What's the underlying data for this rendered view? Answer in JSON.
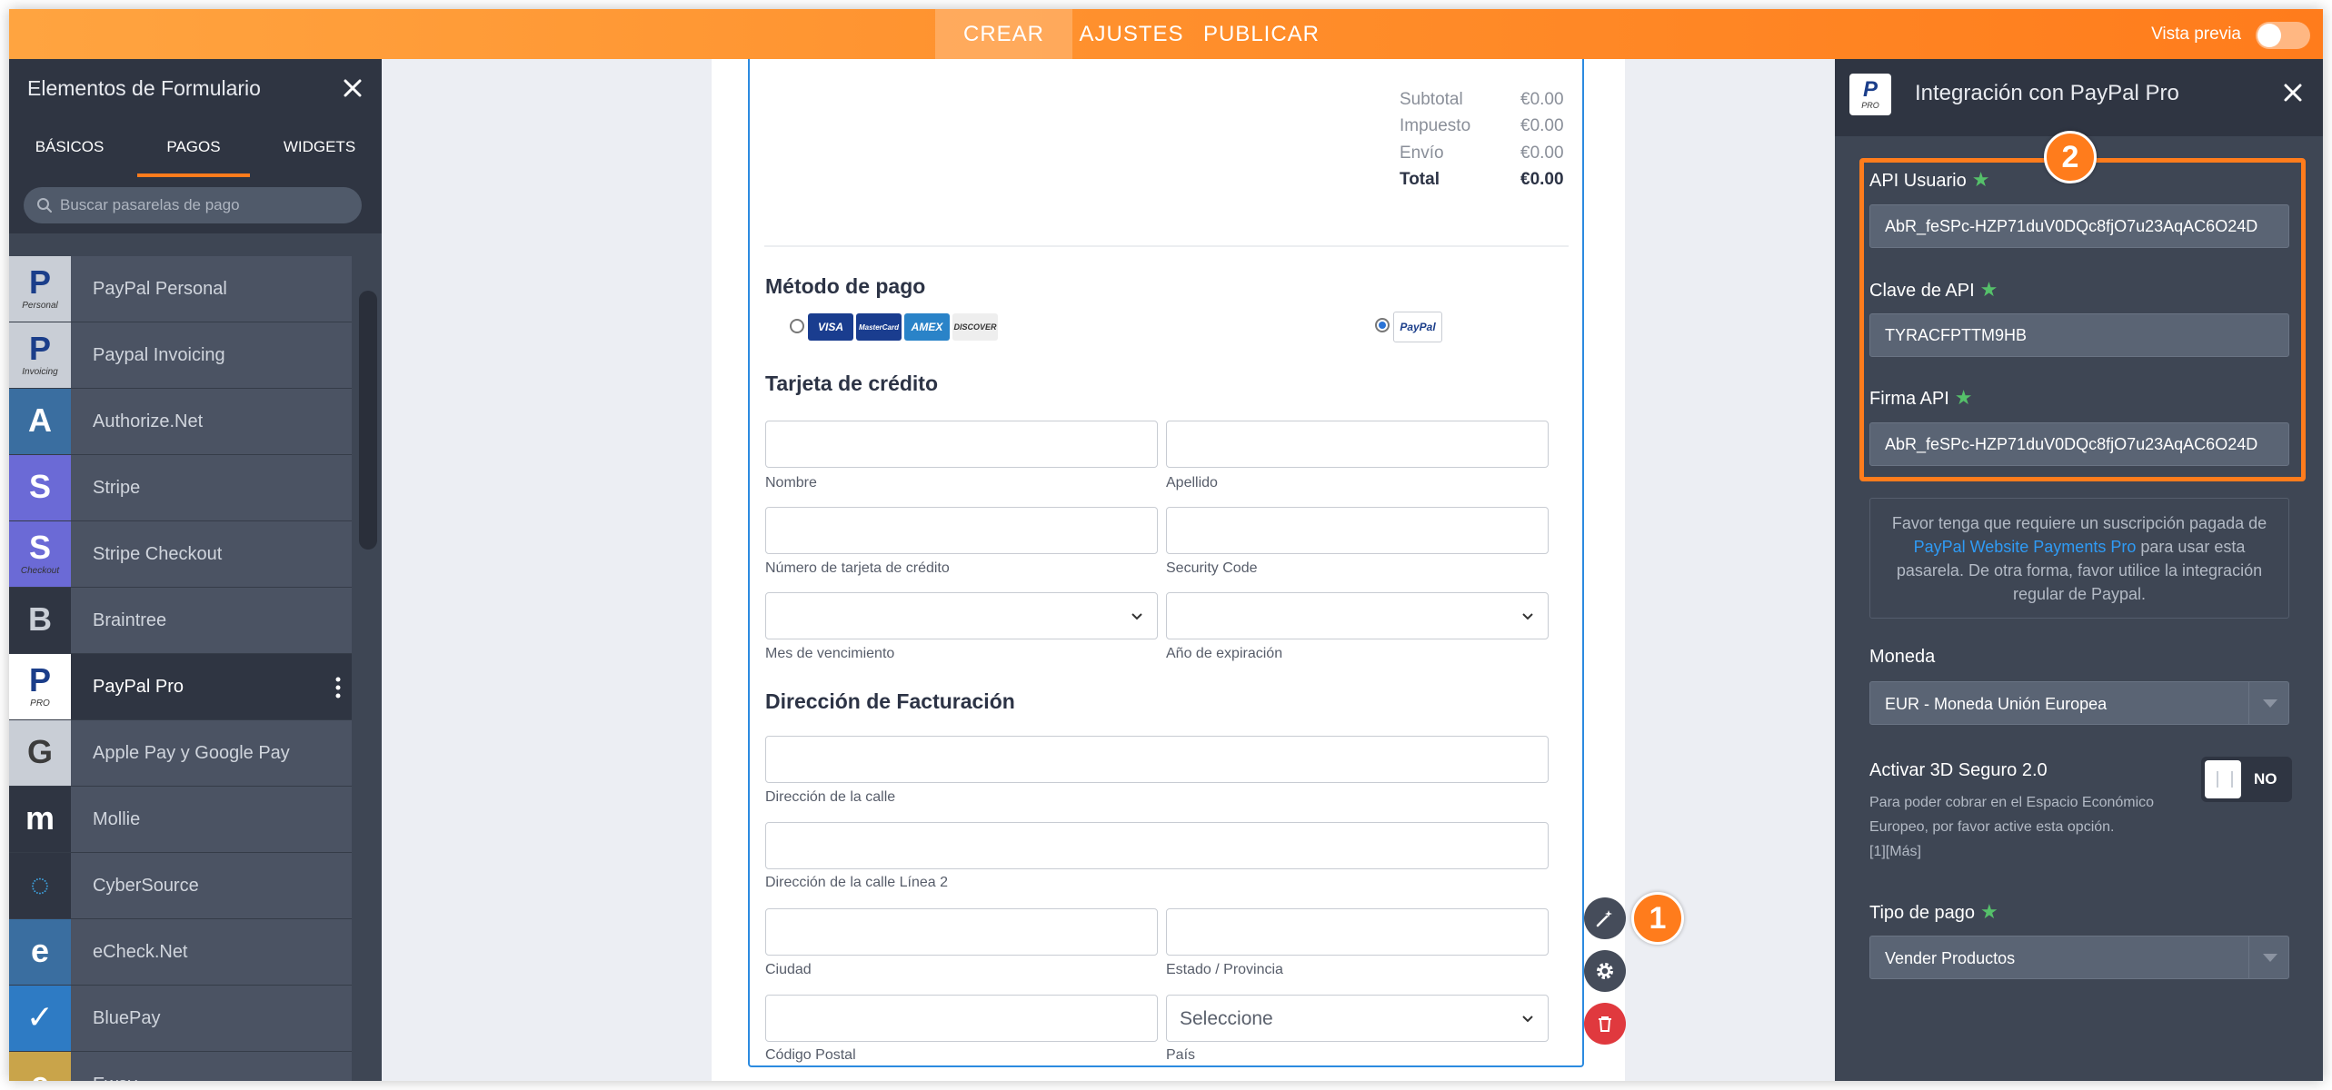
{
  "topbar": {
    "tabs": [
      "CREAR",
      "AJUSTES",
      "PUBLICAR"
    ],
    "active_tab": "CREAR",
    "preview_label": "Vista previa"
  },
  "left_panel": {
    "title": "Elementos de Formulario",
    "tabs": [
      "BÁSICOS",
      "PAGOS",
      "WIDGETS"
    ],
    "active_tab": "PAGOS",
    "search_placeholder": "Buscar pasarelas de pago",
    "gateways": [
      {
        "label": "PayPal Personal",
        "glyph": "P",
        "sub": "Personal",
        "icon": "paypal-personal-icon",
        "bg": "#c9ced6",
        "fg": "#1b3e8a"
      },
      {
        "label": "Paypal Invoicing",
        "glyph": "P",
        "sub": "Invoicing",
        "icon": "paypal-invoicing-icon",
        "bg": "#c9ced6",
        "fg": "#1b3e8a"
      },
      {
        "label": "Authorize.Net",
        "glyph": "A",
        "sub": "",
        "icon": "authorize-net-icon",
        "bg": "#3a6ea0",
        "fg": "#ffffff"
      },
      {
        "label": "Stripe",
        "glyph": "S",
        "sub": "",
        "icon": "stripe-icon",
        "bg": "#6b6ad6",
        "fg": "#ffffff"
      },
      {
        "label": "Stripe Checkout",
        "glyph": "S",
        "sub": "Checkout",
        "icon": "stripe-checkout-icon",
        "bg": "#6b6ad6",
        "fg": "#ffffff"
      },
      {
        "label": "Braintree",
        "glyph": "B",
        "sub": "",
        "icon": "braintree-icon",
        "bg": "#2f3542",
        "fg": "#c9ced6"
      },
      {
        "label": "PayPal Pro",
        "glyph": "P",
        "sub": "PRO",
        "icon": "paypal-pro-icon",
        "bg": "#ffffff",
        "fg": "#1b3e8a"
      },
      {
        "label": "Apple Pay y Google Pay",
        "glyph": "G",
        "sub": "",
        "icon": "apple-google-pay-icon",
        "bg": "#c9ced6",
        "fg": "#3c3c3c"
      },
      {
        "label": "Mollie",
        "glyph": "m",
        "sub": "",
        "icon": "mollie-icon",
        "bg": "#2f3542",
        "fg": "#ffffff"
      },
      {
        "label": "CyberSource",
        "glyph": "◌",
        "sub": "",
        "icon": "cybersource-icon",
        "bg": "#2f3542",
        "fg": "#3da2e0"
      },
      {
        "label": "eCheck.Net",
        "glyph": "e",
        "sub": "",
        "icon": "echeck-net-icon",
        "bg": "#3a6ea0",
        "fg": "#ffffff"
      },
      {
        "label": "BluePay",
        "glyph": "✓",
        "sub": "",
        "icon": "bluepay-icon",
        "bg": "#2e7bc4",
        "fg": "#ffffff"
      },
      {
        "label": "Eway",
        "glyph": "e",
        "sub": "",
        "icon": "eway-icon",
        "bg": "#c9a44a",
        "fg": "#ffffff"
      }
    ],
    "active_gateway": "PayPal Pro"
  },
  "form": {
    "summary": [
      {
        "label": "Subtotal",
        "value": "€0.00"
      },
      {
        "label": "Impuesto",
        "value": "€0.00"
      },
      {
        "label": "Envío",
        "value": "€0.00"
      },
      {
        "label": "Total",
        "value": "€0.00"
      }
    ],
    "payment_method_title": "Método de pago",
    "card_logos": [
      "VISA",
      "MasterCard",
      "AMEX",
      "DISCOVER"
    ],
    "paypal_logo": "PayPal",
    "credit_card_title": "Tarjeta de  crédito",
    "labels": {
      "first_name": "Nombre",
      "last_name": "Apellido",
      "card_number": "Número de tarjeta de crédito",
      "security_code": "Security Code",
      "exp_month": "Mes de vencimiento",
      "exp_year": "Año de expiración",
      "street": "Dirección de la calle",
      "street2": "Dirección de la calle Línea 2",
      "city": "Ciudad",
      "state": "Estado / Provincia",
      "zip": "Código Postal",
      "country": "País"
    },
    "billing_title": "Dirección de Facturación",
    "country_select": "Seleccione"
  },
  "badges": {
    "step1": "1",
    "step2": "2"
  },
  "right_panel": {
    "title": "Integración con PayPal Pro",
    "api_user_label": "API Usuario",
    "api_user_value": "AbR_feSPc-HZP71duV0DQc8fjO7u23AqAC6O24D",
    "api_key_label": "Clave de API",
    "api_key_value": "TYRACFPTTM9HB",
    "api_signature_label": "Firma API",
    "api_signature_value": "AbR_feSPc-HZP71duV0DQc8fjO7u23AqAC6O24D",
    "note_before": "Favor tenga que requiere un suscripción pagada de ",
    "note_link": "PayPal Website Payments Pro",
    "note_after": " para usar esta pasarela. De otra forma, favor utilice la integración regular de Paypal.",
    "currency_label": "Moneda",
    "currency_value": "EUR - Moneda Unión Europea",
    "secure_label": "Activar 3D Seguro 2.0",
    "secure_desc": "Para poder cobrar en el Espacio Económico Europeo, por favor active esta opción.",
    "secure_more": "[1][Más]",
    "secure_toggle": "NO",
    "payment_type_label": "Tipo de pago",
    "payment_type_value": "Vender Productos"
  },
  "colors": {
    "accent": "#ff7c1c",
    "link": "#2f9bf5",
    "panel": "#3e4654",
    "required": "#55c06a"
  }
}
